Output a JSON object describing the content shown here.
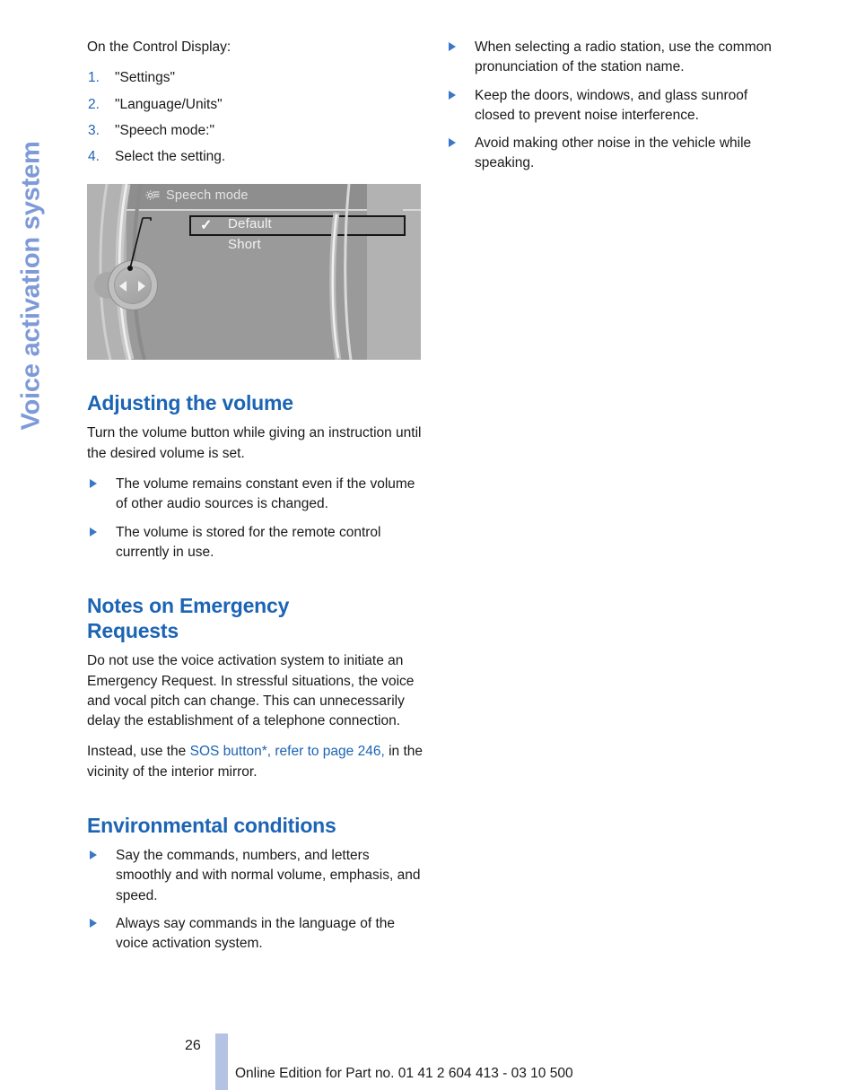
{
  "running_head": "Voice activation system",
  "colors": {
    "heading_blue": "#1c64b4",
    "running_head_blue": "#7e9ad8",
    "bullet_blue": "#3b77c4",
    "footer_bar_blue": "#b4c2e4"
  },
  "left_column": {
    "lead": "On the Control Display:",
    "numbered_steps": [
      {
        "num": "1.",
        "text": "\"Settings\""
      },
      {
        "num": "2.",
        "text": "\"Language/Units\""
      },
      {
        "num": "3.",
        "text": "\"Speech mode:\""
      },
      {
        "num": "4.",
        "text": "Select the setting."
      }
    ],
    "control_display": {
      "title": "Speech mode",
      "gear_icon": "settings-gear-icon",
      "options": [
        {
          "label": "Default",
          "selected": true,
          "checked": true
        },
        {
          "label": "Short",
          "selected": false,
          "checked": false
        }
      ],
      "checkmark": "✓",
      "controller_arrow_left": "left-arrow-icon",
      "controller_arrow_right": "right-arrow-icon"
    },
    "sections": [
      {
        "heading": "Adjusting the volume",
        "paragraph": "Turn the volume button while giving an instruction until the desired volume is set.",
        "bullets": [
          "The volume remains constant even if the volume of other audio sources is changed.",
          "The volume is stored for the remote control currently in use."
        ]
      },
      {
        "heading": "Notes on Emergency Requests",
        "paragraph": "Do not use the voice activation system to initiate an Emergency Request. In stressful situations, the voice and vocal pitch can change. This can unnecessarily delay the establishment of a telephone connection.",
        "cross_reference": {
          "before": "Instead, use the ",
          "link": "SOS button*, refer to page 246,",
          "after": " in the vicinity of the interior mirror."
        }
      },
      {
        "heading": "Environmental conditions",
        "bullets": [
          "Say the commands, numbers, and letters smoothly and with normal volume, emphasis, and speed.",
          "Always say commands in the language of the voice activation system."
        ]
      }
    ]
  },
  "right_column": {
    "bullets": [
      "When selecting a radio station, use the common pronunciation of the station name.",
      "Keep the doors, windows, and glass sunroof closed to prevent noise interference.",
      "Avoid making other noise in the vehicle while speaking."
    ]
  },
  "footer": {
    "page_number": "26",
    "text": "Online Edition for Part no. 01 41 2 604 413 - 03 10 500"
  }
}
